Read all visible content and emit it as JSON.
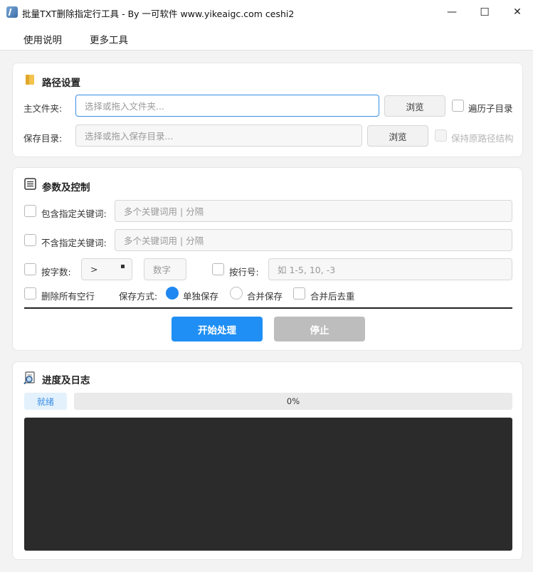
{
  "window": {
    "title": "批量TXT删除指定行工具 - By 一可软件 www.yikeaigc.com ceshi2",
    "minimize_glyph": "—",
    "maximize_glyph": "☐",
    "close_glyph": "✕"
  },
  "menu": {
    "items": [
      "使用说明",
      "更多工具"
    ]
  },
  "path_section": {
    "title": "路径设置",
    "icon": "folder-icon",
    "main_folder_label": "主文件夹:",
    "main_folder_placeholder": "选择或拖入文件夹...",
    "main_folder_value": "",
    "browse_label": "浏览",
    "recurse_label": "遍历子目录",
    "save_dir_label": "保存目录:",
    "save_dir_placeholder": "选择或拖入保存目录...",
    "save_dir_value": "",
    "keep_structure_label": "保持原路径结构"
  },
  "params_section": {
    "title": "参数及控制",
    "icon": "list-icon",
    "include_label": "包含指定关键词:",
    "include_placeholder": "多个关键词用 | 分隔",
    "exclude_label": "不含指定关键词:",
    "exclude_placeholder": "多个关键词用 | 分隔",
    "char_count_label": "按字数:",
    "operator_value": ">",
    "char_count_placeholder": "数字",
    "line_no_label": "按行号:",
    "line_no_placeholder": "如 1-5, 10, -3",
    "remove_empty_label": "删除所有空行",
    "save_mode_label": "保存方式:",
    "save_modes": [
      "单独保存",
      "合并保存"
    ],
    "selected_save_mode": "单独保存",
    "dedupe_label": "合并后去重",
    "start_label": "开始处理",
    "stop_label": "停止"
  },
  "log_section": {
    "title": "进度及日志",
    "icon": "magnifier-log-icon",
    "status": "就绪",
    "progress_text": "0%",
    "progress_value": 0
  },
  "colors": {
    "accent": "#1f8ff5",
    "log_bg": "#2b2b2b",
    "status_bg": "#e3f1fc",
    "status_text": "#3a8ee6"
  }
}
